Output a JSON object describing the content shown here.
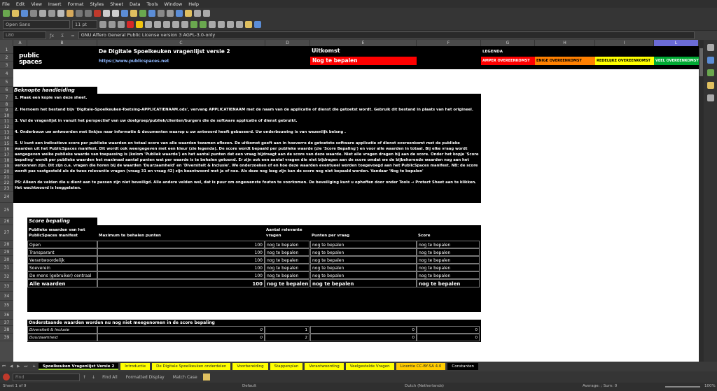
{
  "menu": [
    "File",
    "Edit",
    "View",
    "Insert",
    "Format",
    "Styles",
    "Sheet",
    "Data",
    "Tools",
    "Window",
    "Help"
  ],
  "toolbar": {
    "font_name": "Open Sans",
    "font_size": "11 pt"
  },
  "formula_bar": {
    "name_box": "L80",
    "content": "GNU Affero General Public License version 3 AGPL-3.0-only"
  },
  "columns": [
    "A",
    "B",
    "C",
    "D",
    "E",
    "F",
    "G",
    "H",
    "I",
    "L"
  ],
  "rows": [
    "1",
    "2",
    "3",
    "4",
    "5",
    "6",
    "7",
    "8",
    "9",
    "10",
    "11",
    "12",
    "13",
    "14",
    "15",
    "16",
    "17",
    "18",
    "19",
    "20",
    "21",
    "22",
    "23",
    "24",
    "25",
    "26",
    "27",
    "28",
    "29",
    "30",
    "31",
    "32",
    "33",
    "34",
    "35",
    "36",
    "37",
    "38",
    "39"
  ],
  "sheet": {
    "logo_line1": "public",
    "logo_line2": "spaces",
    "title": "De Digitale Spoelkeuken vragenlijst versie 2",
    "url": "https://www.publicspaces.net",
    "uitkomst_label": "Uitkomst",
    "uitkomst_value": "Nog te bepalen",
    "legend_title": "LEGENDA",
    "legend": [
      {
        "label": "AMPER OVEREENKOMST",
        "color": "#ff0000"
      },
      {
        "label": "ENIGE OVEREENKOMST",
        "color": "#ff8000"
      },
      {
        "label": "REDELIJKE OVEREENKOMST",
        "color": "#ffff00"
      },
      {
        "label": "VEEL OVEREENKOMST",
        "color": "#00a933"
      }
    ],
    "handleiding_title": "Beknopte handleiding",
    "handleiding": [
      "1. Maak een kopie van deze sheet.",
      "2. Hernoem het bestand bijv 'Digitale-Spoelkeuken-Toetsing-APPLICATIENAAM.ods', vervang APPLICATIENAAM met de naam van de applicatie of dienst die getoetst wordt. Gebruik dit bestand in plaats van het origineel.",
      "3. Vul de vragenlijst in vanuit het perspectief van uw doelgroep/publiek/clienten/burgers die de software applicatie of dienst gebruikt.",
      "4. Onderbouw uw antwoorden met linkjes naar informatie & documenten waarop u uw antwoord heeft gebaseerd. Uw onderbouwing is van wezenlijk belang .",
      "5. U kunt een indicatieve score per publieke waarden en totaal score van alle waarden tezamen aflezen. De uitkomst geeft aan in hoeverre de getoetste software applicatie of dienst overeenkomt met de publieke",
      "waarden uit het PublicSpaces manifest. Dit wordt ook weergegeven met een kleur (zie legenda).  De score wordt bepaald per publieke waarde (zie 'Score Bepaling') en voor alle waarden in totaal. Bij elke vraag wordt",
      "aangegeven welke publieke waarde van toepassing is (kolom 'Publiek waarde') en het aantal punten dat een vraag bijdraagt aan de score van deze waarde. Niet alle vragen dragen bij aan de score. Onder het kopje 'Score",
      "bepaling' wordt per publieke waarden het maximaal aantal punten wat per waarde is te behalen getoond.  Er zijn ook een aantal vragen die niet bijdragen aan de score omdat we de bijbehorende waarden nog aan het",
      "verkennen zijn. Dit zijn o.a. vragen die horen bij de waarden 'Duurzaamheid' en 'Diversiteit & Inclusie'. We onderzoeken of en hoe deze waarden eventueel worden toegevoegd aan het PublicSpaces manifest. NB: de score",
      "wordt pas vastgesteld als de twee relevantie vragen (vraag 31 en vraag 42) zijn beantwoord met ja of nee. Als deze nog leeg zijn kan de score nog niet bepaald worden. Vandaar 'Nog te bepalen'",
      "PS: Alleen de velden die u dient aan te passen zijn niet beveiligd. Alle andere velden wel, dat is puur om ongewenste fouten te voorkomen. De beveiliging kunt u opheffen door onder Tools → Protect Sheet aan te klikken.",
      "Het wachtwoord is leeggelaten."
    ],
    "score_title": "Score bepaling",
    "score_headers": [
      "Publieke waarden van het PublicSpaces manifest",
      "Maximum te behalen punten",
      "Aantal relevante vragen",
      "Punten per vraag",
      "Score"
    ],
    "score_rows": [
      [
        "Open",
        "100",
        "nog te bepalen",
        "nog te bepalen",
        "nog te bepalen"
      ],
      [
        "Transparant",
        "100",
        "nog te bepalen",
        "nog te bepalen",
        "nog te bepalen"
      ],
      [
        "Verantwoordelijk",
        "100",
        "nog te bepalen",
        "nog te bepalen",
        "nog te bepalen"
      ],
      [
        "Soeverein",
        "100",
        "nog te bepalen",
        "nog te bepalen",
        "nog te bepalen"
      ],
      [
        "De mens (gebruiker) centraal",
        "100",
        "nog te bepalen",
        "nog te bepalen",
        "nog te bepalen"
      ]
    ],
    "total_row": [
      "Alle waarden",
      "100",
      "nog te bepalen",
      "nog te bepalen",
      "nog te bepalen"
    ],
    "extra_title": "Onderstaande waarden worden nu nog niet meegenomen in de score bepaling",
    "extra_rows": [
      [
        "Diversiteit & Inclusie",
        "0",
        "1",
        "0",
        "0"
      ],
      [
        "Duurzaamheid",
        "0",
        "2",
        "0",
        "0"
      ]
    ]
  },
  "tabs": [
    {
      "label": "Spoelkeuken Vragenlijst Versie 2",
      "color": "#9acd32"
    },
    {
      "label": "Introductie",
      "color": "#ffff00"
    },
    {
      "label": "De Digitale Spoelkeuken onderdelen",
      "color": "#ffff00"
    },
    {
      "label": "Voorbereiding",
      "color": "#ffff00"
    },
    {
      "label": "Stappenplan",
      "color": "#ffff00"
    },
    {
      "label": "Verantwoording",
      "color": "#ffff00"
    },
    {
      "label": "Veelgestelde Vragen",
      "color": "#ffff00"
    },
    {
      "label": "Licentie CC-BY-SA 4.0",
      "color": "#ffcc00"
    },
    {
      "label": "Constanten",
      "color": "#000000"
    }
  ],
  "findbar": {
    "placeholder": "Find",
    "find_all": "Find All",
    "formatted": "Formatted Display",
    "match_case": "Match Case"
  },
  "status": {
    "sheet": "Sheet 1 of 9",
    "style": "Default",
    "language": "Dutch (Netherlands)",
    "summary": "Average: ; Sum: 0",
    "zoom": "100%"
  }
}
